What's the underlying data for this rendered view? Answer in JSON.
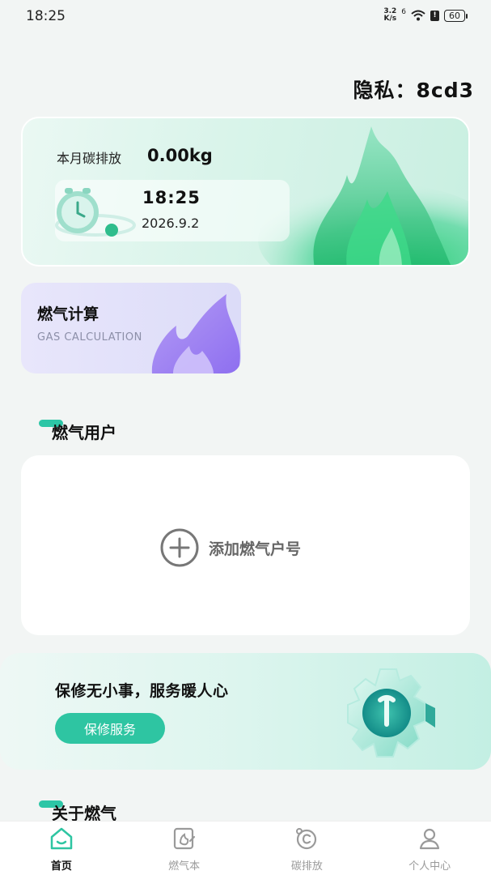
{
  "status_bar": {
    "time": "18:25",
    "speed_value": "3.2",
    "speed_unit": "K/s",
    "signal": "6",
    "battery": "60"
  },
  "header": {
    "privacy_label": "隐私：",
    "privacy_value": "8cd3"
  },
  "carbon_card": {
    "label": "本月碳排放",
    "value": "0.00kg",
    "time": "18:25",
    "date": "2026.9.2"
  },
  "gas_calc_card": {
    "title": "燃气计算",
    "subtitle": "GAS CALCULATION"
  },
  "gas_users_section": {
    "title": "燃气用户",
    "add_label": "添加燃气户号"
  },
  "repair_banner": {
    "text": "保修无小事，服务暖人心",
    "button_label": "保修服务"
  },
  "about_section": {
    "title": "关于燃气"
  },
  "bottom_nav": {
    "items": [
      {
        "label": "首页",
        "icon": "home-icon",
        "active": true
      },
      {
        "label": "燃气本",
        "icon": "gas-book-icon",
        "active": false
      },
      {
        "label": "碳排放",
        "icon": "carbon-icon",
        "active": false
      },
      {
        "label": "个人中心",
        "icon": "profile-icon",
        "active": false
      }
    ]
  },
  "colors": {
    "accent": "#2ec5a2",
    "background": "#f2f5f4",
    "gas_card": "#dcdcf8"
  }
}
